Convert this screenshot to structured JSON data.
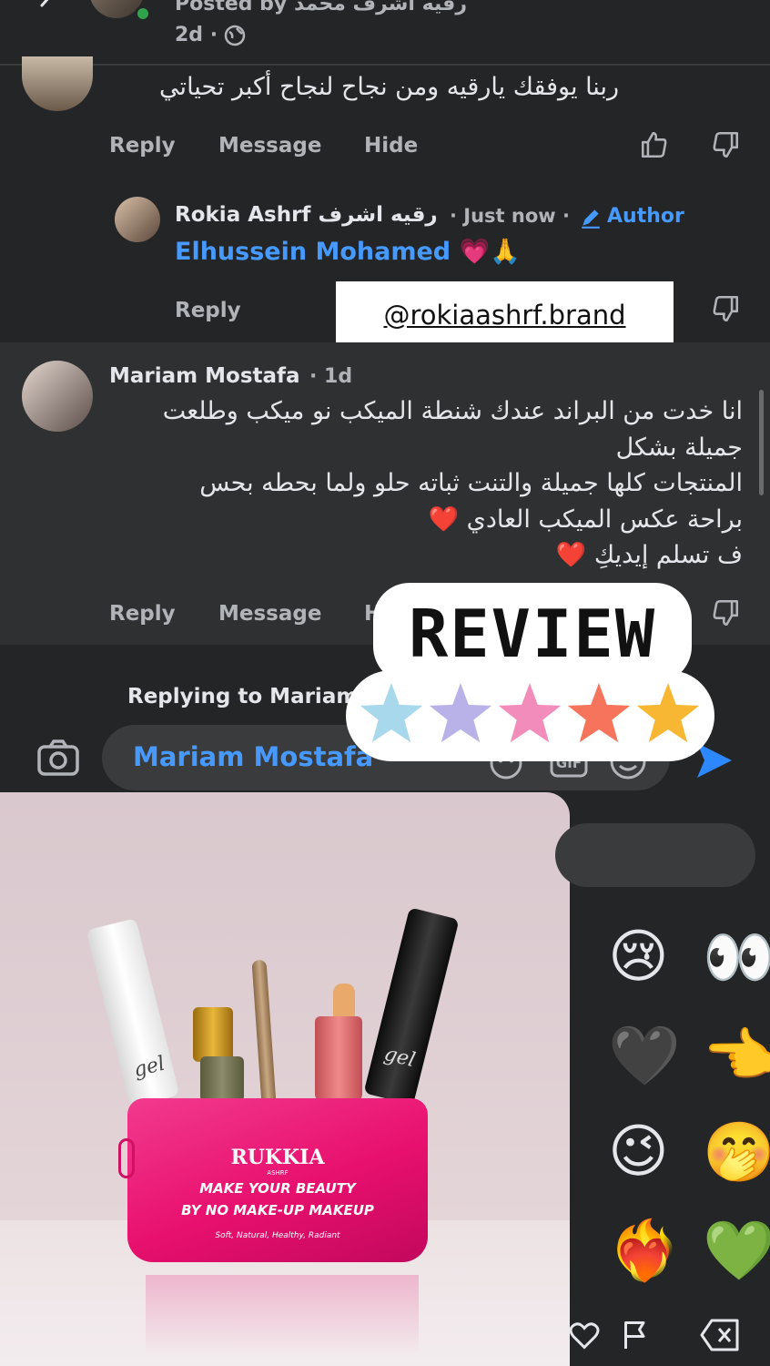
{
  "header": {
    "posted_by": "Posted by رقيه اشرف محمد",
    "meta": "2d ·"
  },
  "comment1": {
    "text": "ربنا يوفقك يارقيه ومن نجاح لنجاح أكبر تحياتي",
    "actions": [
      "Reply",
      "Message",
      "Hide"
    ]
  },
  "reply": {
    "name": "Rokia Ashrf رقيه اشرف",
    "time": "· Just now ·",
    "badge": "Author",
    "text": "Elhussein Mohamed 💗🙏",
    "action": "Reply"
  },
  "brand_tag": "@rokiaashrf.brand",
  "comment2": {
    "name": "Mariam Mostafa",
    "time": "· 1d",
    "lines": [
      "انا خدت من البراند عندك شنطة الميكب نو ميكب وطلعت",
      "جميلة بشكل",
      "المنتجات كلها جميلة والتنت ثباته حلو ولما بحطه بحس",
      "براحة عكس الميكب العادي ❤️",
      "ف تسلم إيديكِ ❤️"
    ],
    "actions": [
      "Reply",
      "Message",
      "H"
    ]
  },
  "review_sticker": {
    "title": "REVIEW",
    "star_colors": [
      "#a7d8ec",
      "#b9b2e8",
      "#f28dbb",
      "#f6735c",
      "#f7b733"
    ]
  },
  "composer": {
    "replying_to": "Replying to Mariam",
    "input_value": "Mariam Mostafa",
    "icons": [
      "camera-icon",
      "sticker-icon",
      "gif-icon",
      "emoji-icon",
      "send-icon"
    ]
  },
  "product": {
    "brand": "RUKKIA",
    "brand_sub": "ASHRF",
    "tagline1": "MAKE YOUR BEAUTY",
    "tagline2": "BY NO MAKE-UP MAKEUP",
    "keywords": "Soft, Natural, Healthy, Radiant",
    "pink": "#e8106e"
  },
  "emoji_panel": {
    "emojis": [
      "😢",
      "👀",
      "🖤",
      "👈",
      "😉",
      "🤭",
      "❤️‍🔥",
      "💚"
    ],
    "bottom_icons": [
      "heart-icon",
      "flag-icon",
      "delete-icon"
    ]
  }
}
